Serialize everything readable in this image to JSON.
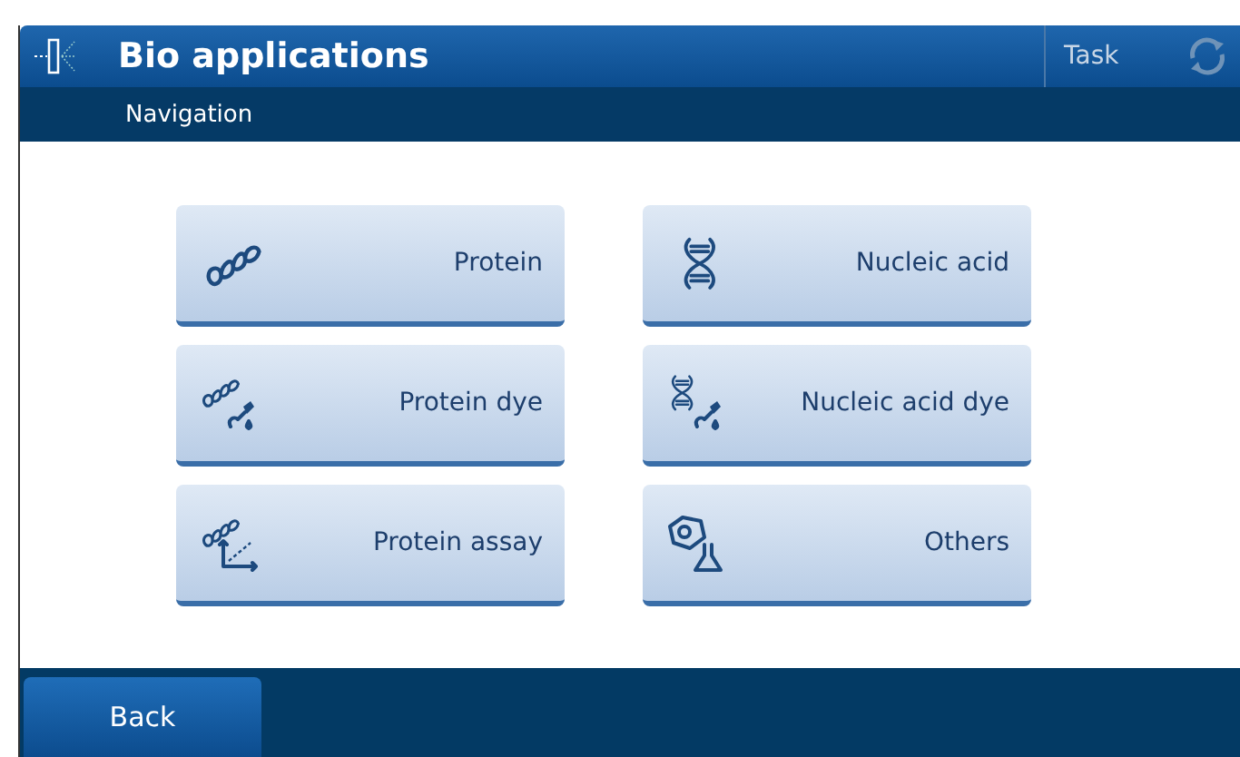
{
  "header": {
    "title": "Bio applications",
    "task_label": "Task"
  },
  "subheader": {
    "title": "Navigation"
  },
  "tiles": [
    {
      "label": "Protein"
    },
    {
      "label": "Nucleic acid"
    },
    {
      "label": "Protein dye"
    },
    {
      "label": "Nucleic acid dye"
    },
    {
      "label": "Protein assay"
    },
    {
      "label": "Others"
    }
  ],
  "footer": {
    "back_label": "Back"
  }
}
